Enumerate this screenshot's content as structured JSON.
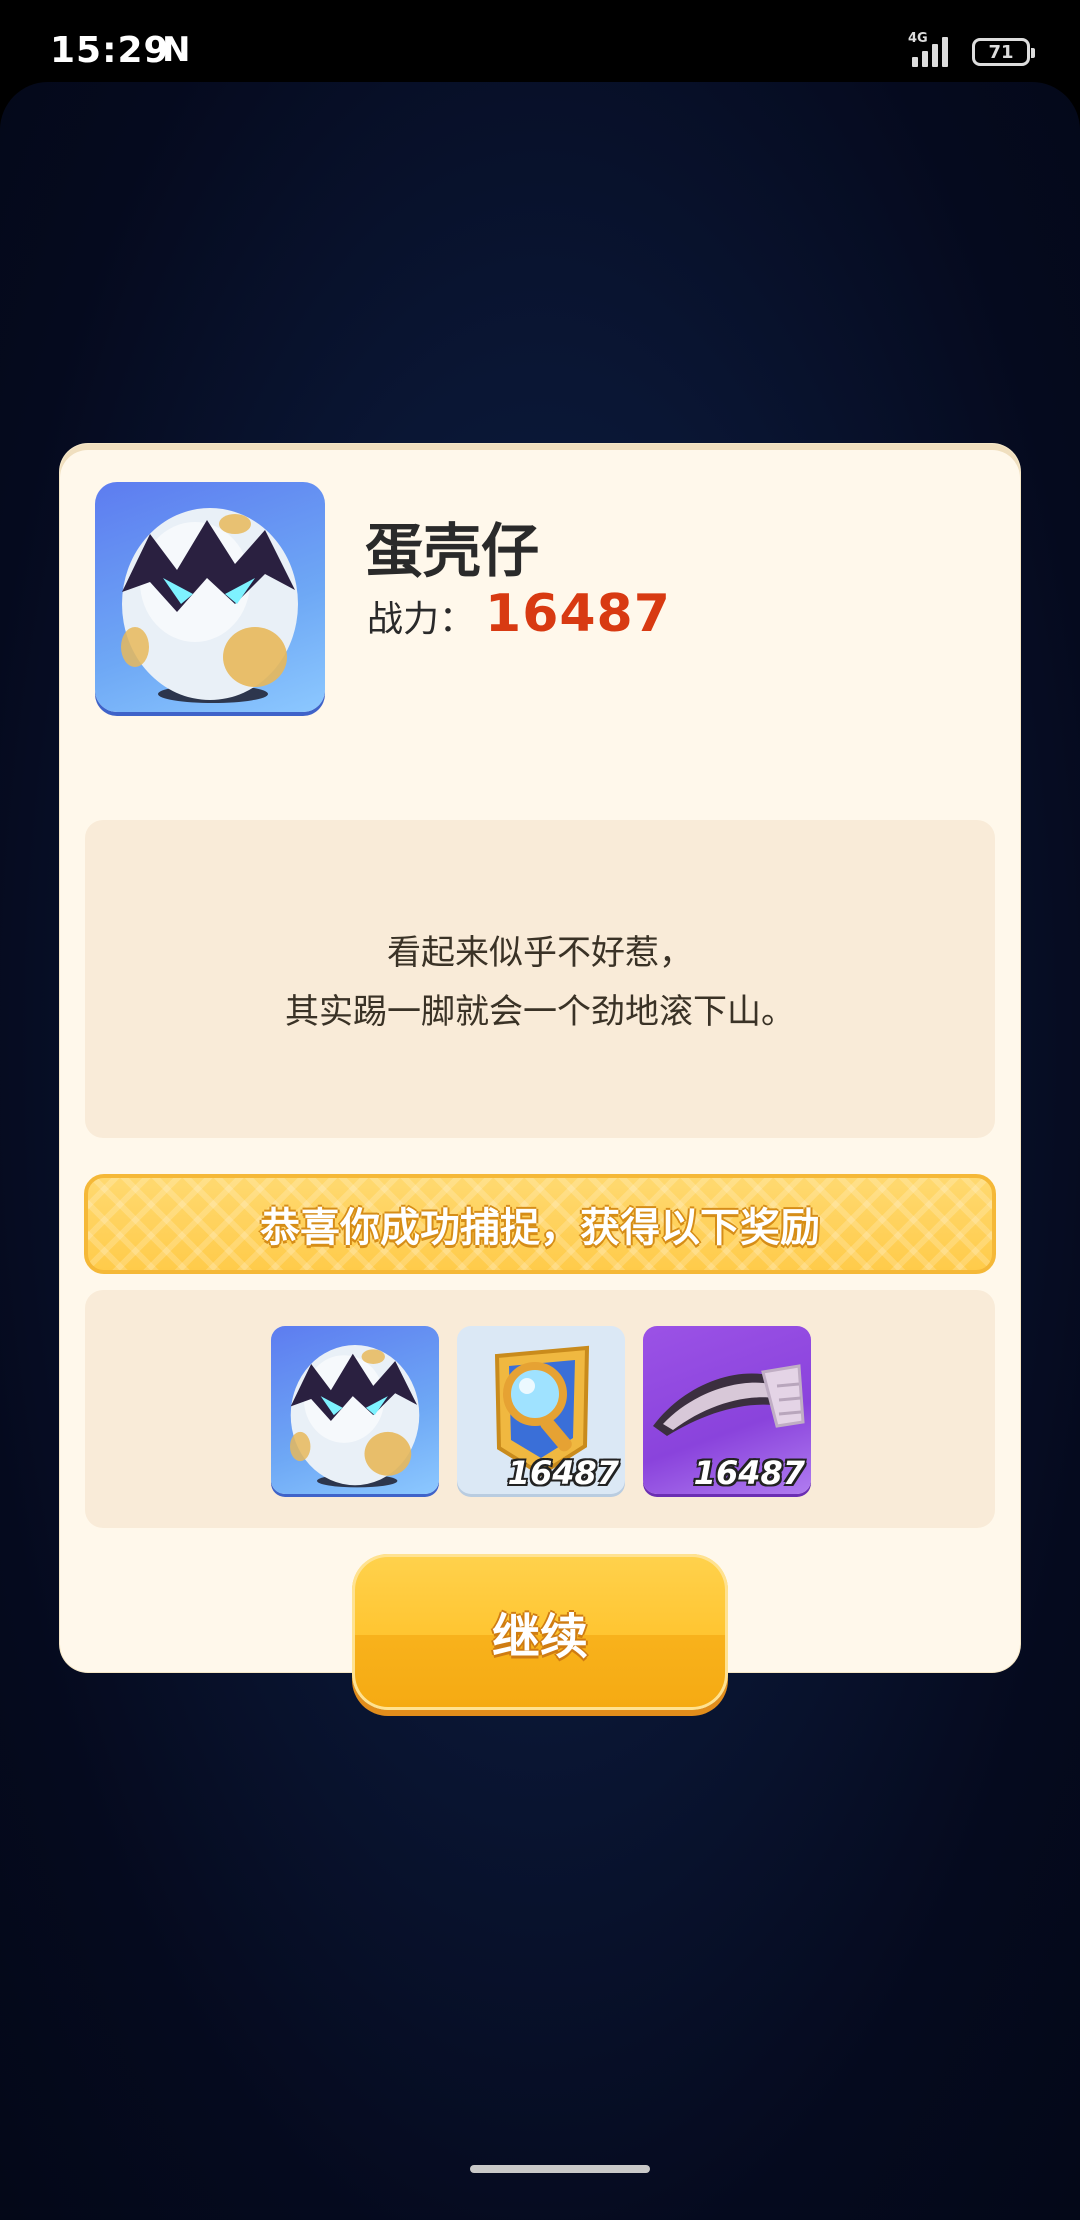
{
  "status_bar": {
    "time": "15:29",
    "notification_icon": "N",
    "network": "4G",
    "battery": "71"
  },
  "dialog": {
    "pet_name": "蛋壳仔",
    "power_label": "战力：",
    "power_value": "16487",
    "description": [
      "看起来似乎不好惹，",
      "其实踢一脚就会一个劲地滚下山。"
    ],
    "reward_banner": "恭喜你成功捕捉，获得以下奖励",
    "rewards": [
      {
        "icon": "egg-pet-icon"
      },
      {
        "icon": "magnifier-card-icon",
        "count": "16487"
      },
      {
        "icon": "horn-item-icon",
        "count": "16487"
      }
    ],
    "continue_label": "继续"
  },
  "colors": {
    "power_value": "#d83a12",
    "dialog_bg": "#fff8eb",
    "banner": "#ffcb4a",
    "button": "#ffc531"
  }
}
